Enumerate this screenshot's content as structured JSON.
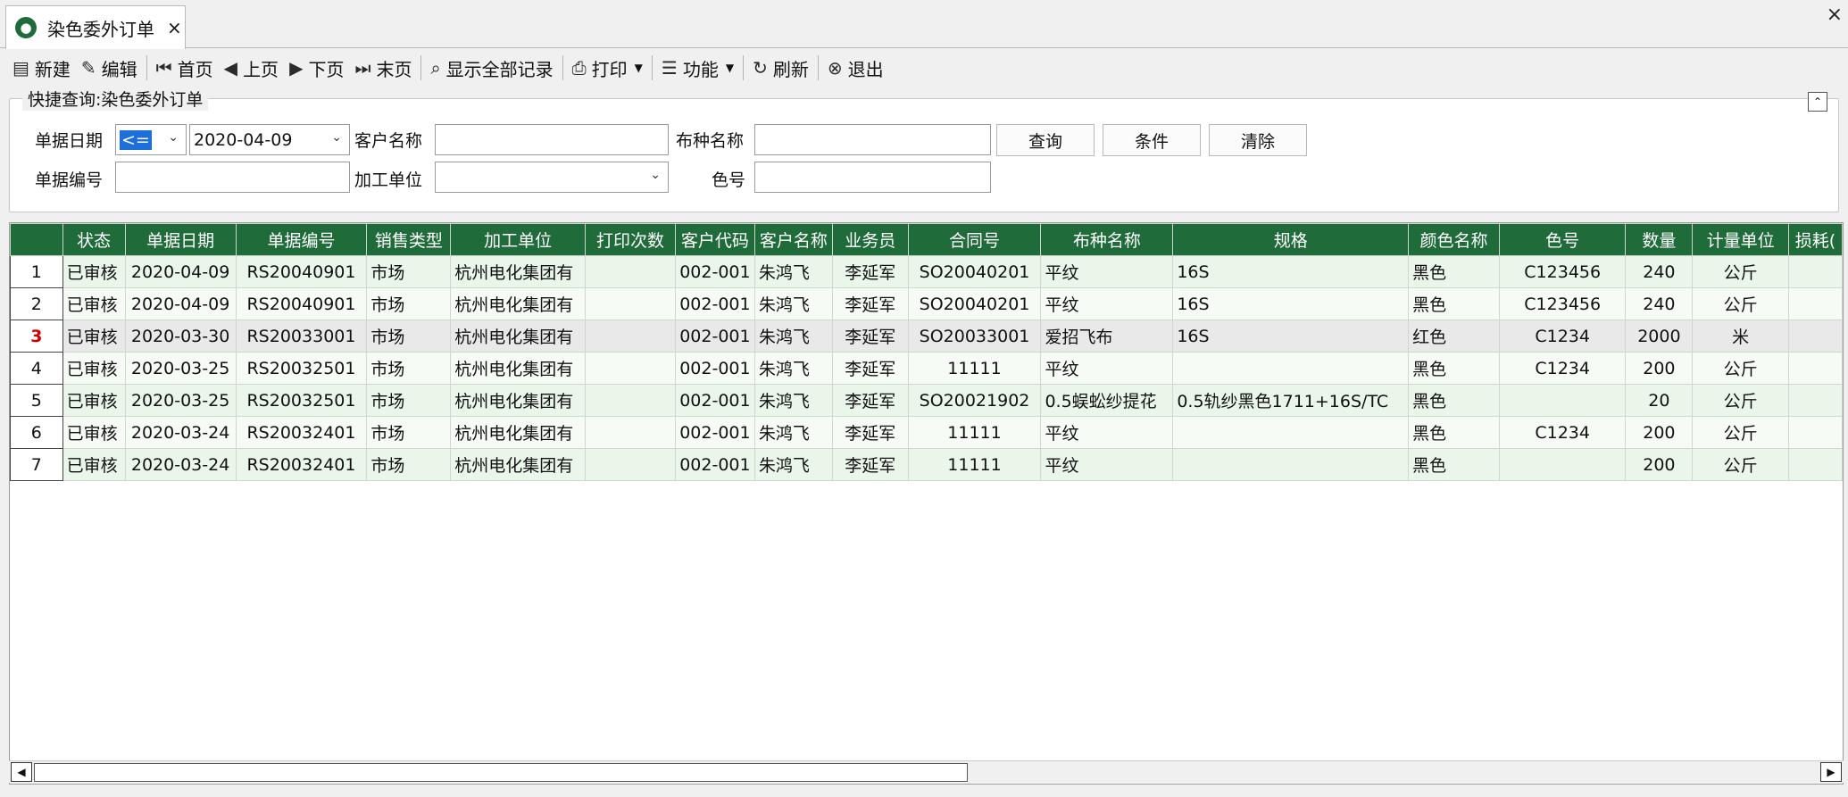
{
  "tab": {
    "title": "染色委外订单",
    "close": "×"
  },
  "window": {
    "close": "×"
  },
  "toolbar": {
    "new": "新建",
    "edit": "编辑",
    "first": "首页",
    "prev": "上页",
    "next": "下页",
    "last": "末页",
    "show_all": "显示全部记录",
    "print": "打印",
    "function": "功能",
    "refresh": "刷新",
    "exit": "退出"
  },
  "query": {
    "legend": "快捷查询:染色委外订单",
    "date_label": "单据日期",
    "date_operator": "<=",
    "date_value": "2020-04-09",
    "customer_label": "客户名称",
    "customer_value": "",
    "fabric_label": "布种名称",
    "fabric_value": "",
    "doc_no_label": "单据编号",
    "doc_no_value": "",
    "processor_label": "加工单位",
    "processor_value": "",
    "color_no_label": "色号",
    "color_no_value": "",
    "search_btn": "查询",
    "condition_btn": "条件",
    "clear_btn": "清除"
  },
  "grid": {
    "columns": [
      "",
      "状态",
      "单据日期",
      "单据编号",
      "销售类型",
      "加工单位",
      "打印次数",
      "客户代码",
      "客户名称",
      "业务员",
      "合同号",
      "布种名称",
      "规格",
      "颜色名称",
      "色号",
      "数量",
      "计量单位",
      "损耗("
    ],
    "rows": [
      [
        "1",
        "已审核",
        "2020-04-09",
        "RS20040901",
        "市场",
        "杭州电化集团有",
        "",
        "002-001",
        "朱鸿飞",
        "李延军",
        "SO20040201",
        "平纹",
        "16S",
        "黑色",
        "C123456",
        "240",
        "公斤",
        ""
      ],
      [
        "2",
        "已审核",
        "2020-04-09",
        "RS20040901",
        "市场",
        "杭州电化集团有",
        "",
        "002-001",
        "朱鸿飞",
        "李延军",
        "SO20040201",
        "平纹",
        "16S",
        "黑色",
        "C123456",
        "240",
        "公斤",
        ""
      ],
      [
        "3",
        "已审核",
        "2020-03-30",
        "RS20033001",
        "市场",
        "杭州电化集团有",
        "",
        "002-001",
        "朱鸿飞",
        "李延军",
        "SO20033001",
        "爱招飞布",
        "16S",
        "红色",
        "C1234",
        "2000",
        "米",
        ""
      ],
      [
        "4",
        "已审核",
        "2020-03-25",
        "RS20032501",
        "市场",
        "杭州电化集团有",
        "",
        "002-001",
        "朱鸿飞",
        "李延军",
        "11111",
        "平纹",
        "",
        "黑色",
        "C1234",
        "200",
        "公斤",
        ""
      ],
      [
        "5",
        "已审核",
        "2020-03-25",
        "RS20032501",
        "市场",
        "杭州电化集团有",
        "",
        "002-001",
        "朱鸿飞",
        "李延军",
        "SO20021902",
        "0.5蜈蚣纱提花",
        "0.5轨纱黑色1711+16S/TC",
        "黑色",
        "",
        "20",
        "公斤",
        ""
      ],
      [
        "6",
        "已审核",
        "2020-03-24",
        "RS20032401",
        "市场",
        "杭州电化集团有",
        "",
        "002-001",
        "朱鸿飞",
        "李延军",
        "11111",
        "平纹",
        "",
        "黑色",
        "C1234",
        "200",
        "公斤",
        ""
      ],
      [
        "7",
        "已审核",
        "2020-03-24",
        "RS20032401",
        "市场",
        "杭州电化集团有",
        "",
        "002-001",
        "朱鸿飞",
        "李延军",
        "11111",
        "平纹",
        "",
        "黑色",
        "",
        "200",
        "公斤",
        ""
      ]
    ],
    "selected_row": 2
  },
  "colors": {
    "accent": "#1f6b3a",
    "row_odd": "#eaf6ea",
    "row_even": "#f6fbf6",
    "row_selected": "#e9e9e9"
  }
}
